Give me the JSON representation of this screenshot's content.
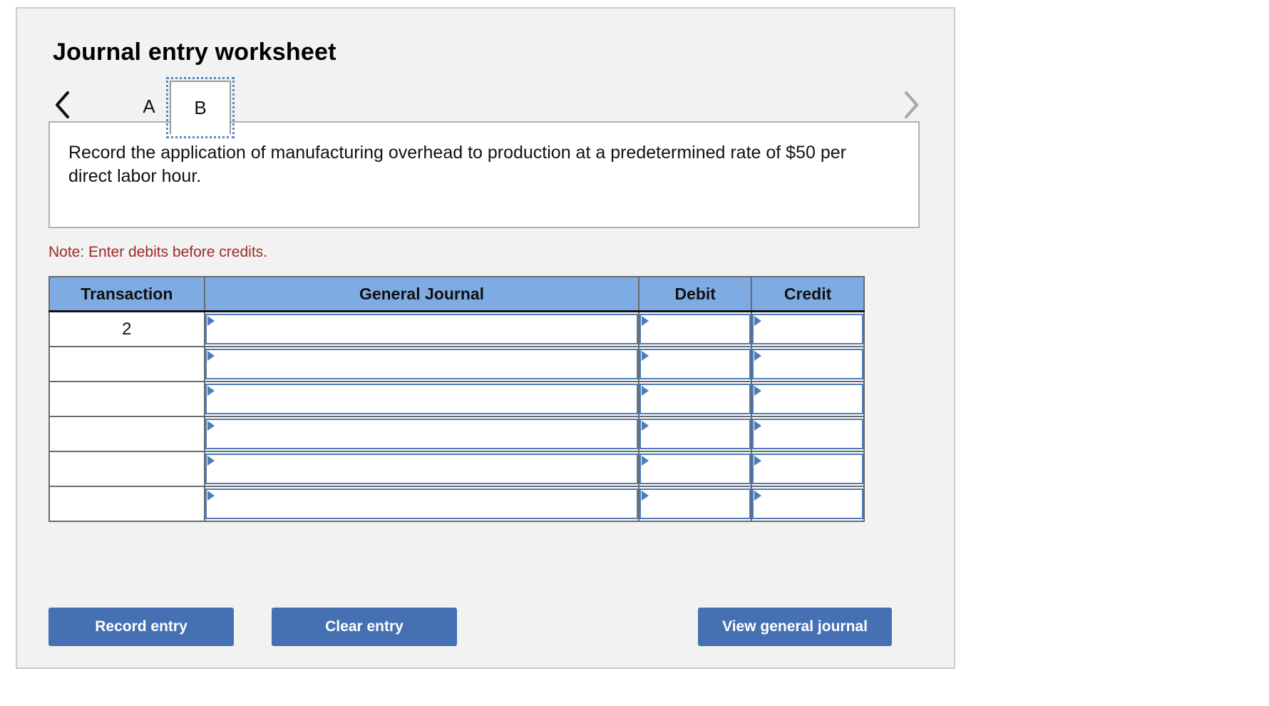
{
  "panel": {
    "title": "Journal entry worksheet"
  },
  "tabs": {
    "prev_icon": "chevron-left-icon",
    "next_icon": "chevron-right-icon",
    "items": [
      {
        "label": "A",
        "selected": false
      },
      {
        "label": "B",
        "selected": true
      }
    ]
  },
  "description": {
    "text": "Record the application of manufacturing overhead to production at a predetermined rate of $50 per direct labor hour."
  },
  "note": {
    "text": "Note: Enter debits before credits."
  },
  "table": {
    "headers": [
      "Transaction",
      "General Journal",
      "Debit",
      "Credit"
    ],
    "rows": [
      {
        "transaction": "2",
        "general_journal": "",
        "debit": "",
        "credit": ""
      },
      {
        "transaction": "",
        "general_journal": "",
        "debit": "",
        "credit": ""
      },
      {
        "transaction": "",
        "general_journal": "",
        "debit": "",
        "credit": ""
      },
      {
        "transaction": "",
        "general_journal": "",
        "debit": "",
        "credit": ""
      },
      {
        "transaction": "",
        "general_journal": "",
        "debit": "",
        "credit": ""
      },
      {
        "transaction": "",
        "general_journal": "",
        "debit": "",
        "credit": ""
      }
    ]
  },
  "buttons": {
    "record_entry": "Record entry",
    "clear_entry": "Clear entry",
    "view_general_journal": "View general journal"
  },
  "colors": {
    "panel_background": "#f2f2f2",
    "table_header_blue": "#7fabe3",
    "button_blue": "#4571b4",
    "note_red": "#9e2b24",
    "input_border_blue": "#4f7cb8"
  }
}
